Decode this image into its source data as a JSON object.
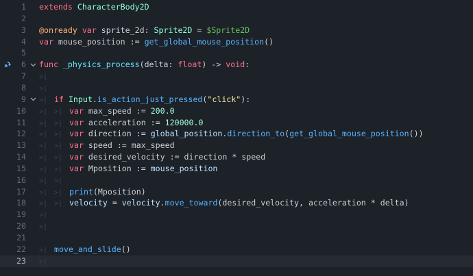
{
  "editor": {
    "language": "GDScript",
    "current_line": 23,
    "colors": {
      "background": "#1d2229",
      "current_line_bg": "#262b33",
      "keyword": "#ff7085",
      "class": "#8fffdb",
      "annotation": "#ffb373",
      "node_path": "#63c259",
      "function_call": "#57b3ff",
      "function_def": "#66e6ff",
      "number": "#a1ffe0",
      "string": "#ffeda1",
      "member": "#bce0ff",
      "text": "#cdcfd2"
    },
    "lines": [
      {
        "n": "1",
        "indent": 0,
        "tokens": [
          [
            "kw",
            "extends"
          ],
          [
            "t",
            " "
          ],
          [
            "cls",
            "CharacterBody2D"
          ]
        ]
      },
      {
        "n": "2",
        "indent": 0,
        "tokens": []
      },
      {
        "n": "3",
        "indent": 0,
        "tokens": [
          [
            "ann",
            "@onready"
          ],
          [
            "t",
            " "
          ],
          [
            "kw",
            "var"
          ],
          [
            "t",
            " sprite_2d: "
          ],
          [
            "cls",
            "Sprite2D"
          ],
          [
            "t",
            " = "
          ],
          [
            "node",
            "$Sprite2D"
          ]
        ]
      },
      {
        "n": "4",
        "indent": 0,
        "tokens": [
          [
            "kw",
            "var"
          ],
          [
            "t",
            " mouse_position := "
          ],
          [
            "fn",
            "get_global_mouse_position"
          ],
          [
            "t",
            "()"
          ]
        ]
      },
      {
        "n": "5",
        "indent": 0,
        "tokens": []
      },
      {
        "n": "6",
        "indent": 0,
        "fold": true,
        "override_icon": true,
        "tokens": [
          [
            "kw",
            "func"
          ],
          [
            "t",
            " "
          ],
          [
            "fnd",
            "_physics_process"
          ],
          [
            "t",
            "(delta: "
          ],
          [
            "kw",
            "float"
          ],
          [
            "t",
            ") -> "
          ],
          [
            "kw",
            "void"
          ],
          [
            "t",
            ":"
          ]
        ]
      },
      {
        "n": "7",
        "indent": 1,
        "tokens": []
      },
      {
        "n": "8",
        "indent": 1,
        "tokens": []
      },
      {
        "n": "9",
        "indent": 1,
        "fold": true,
        "tokens": [
          [
            "kw",
            "if"
          ],
          [
            "t",
            " "
          ],
          [
            "cls",
            "Input"
          ],
          [
            "t",
            "."
          ],
          [
            "fn",
            "is_action_just_pressed"
          ],
          [
            "t",
            "("
          ],
          [
            "str",
            "\"click\""
          ],
          [
            "t",
            "):"
          ]
        ]
      },
      {
        "n": "10",
        "indent": 2,
        "tokens": [
          [
            "kw",
            "var"
          ],
          [
            "t",
            " max_speed := "
          ],
          [
            "num",
            "200.0"
          ]
        ]
      },
      {
        "n": "11",
        "indent": 2,
        "tokens": [
          [
            "kw",
            "var"
          ],
          [
            "t",
            " acceleration := "
          ],
          [
            "num",
            "120000.0"
          ]
        ]
      },
      {
        "n": "12",
        "indent": 2,
        "tokens": [
          [
            "kw",
            "var"
          ],
          [
            "t",
            " direction := "
          ],
          [
            "mem",
            "global_position"
          ],
          [
            "t",
            "."
          ],
          [
            "fn",
            "direction_to"
          ],
          [
            "t",
            "("
          ],
          [
            "fn",
            "get_global_mouse_position"
          ],
          [
            "t",
            "())"
          ]
        ]
      },
      {
        "n": "13",
        "indent": 2,
        "tokens": [
          [
            "kw",
            "var"
          ],
          [
            "t",
            " speed := max_speed"
          ]
        ]
      },
      {
        "n": "14",
        "indent": 2,
        "tokens": [
          [
            "kw",
            "var"
          ],
          [
            "t",
            " desired_velocity := direction * speed"
          ]
        ]
      },
      {
        "n": "15",
        "indent": 2,
        "tokens": [
          [
            "kw",
            "var"
          ],
          [
            "t",
            " Mposition := "
          ],
          [
            "mem",
            "mouse_position"
          ]
        ]
      },
      {
        "n": "16",
        "indent": 2,
        "tokens": []
      },
      {
        "n": "17",
        "indent": 2,
        "tokens": [
          [
            "fn",
            "print"
          ],
          [
            "t",
            "(Mposition)"
          ]
        ]
      },
      {
        "n": "18",
        "indent": 2,
        "tokens": [
          [
            "mem",
            "velocity"
          ],
          [
            "t",
            " = "
          ],
          [
            "mem",
            "velocity"
          ],
          [
            "t",
            "."
          ],
          [
            "fn",
            "move_toward"
          ],
          [
            "t",
            "(desired_velocity, acceleration * delta)"
          ]
        ]
      },
      {
        "n": "19",
        "indent": 1,
        "tokens": []
      },
      {
        "n": "20",
        "indent": 1,
        "tokens": []
      },
      {
        "n": "21",
        "indent": 0,
        "tokens": []
      },
      {
        "n": "22",
        "indent": 1,
        "tokens": [
          [
            "fn",
            "move_and_slide"
          ],
          [
            "t",
            "()"
          ]
        ]
      },
      {
        "n": "23",
        "indent": 1,
        "tokens": []
      }
    ]
  }
}
